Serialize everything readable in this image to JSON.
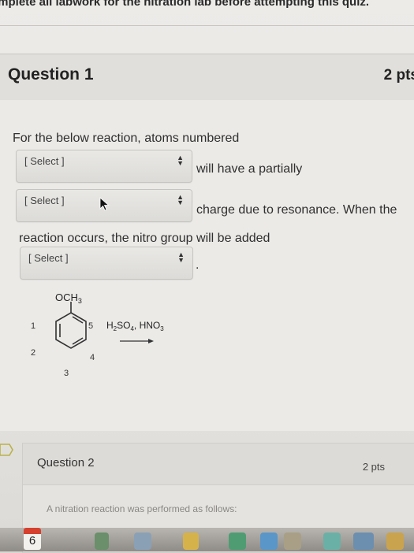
{
  "banner": {
    "text": "omplete all labwork for the nitration lab before attempting this quiz."
  },
  "question1": {
    "title": "Question 1",
    "points": "2 pts",
    "text_line1": "For the below reaction, atoms numbered",
    "select1": "[ Select ]",
    "text_after_select1": "will have a partially",
    "select2": "[ Select ]",
    "text_after_select2": "charge due to resonance. When the",
    "text_line3": "reaction occurs, the nitro group will be added",
    "select3": "[ Select ]",
    "text_after_select3": "."
  },
  "molecule": {
    "substituent": "OCH",
    "substituent_sub": "3",
    "atoms": [
      "1",
      "2",
      "3",
      "4",
      "5"
    ],
    "reagent": {
      "p1": "H",
      "s1": "2",
      "p2": "SO",
      "s2": "4",
      "p3": ", HNO",
      "s3": "3"
    }
  },
  "question2": {
    "title": "Question 2",
    "points": "2 pts",
    "text": "A nitration reaction was performed as follows:"
  },
  "dock": {
    "calendar_day": "6"
  },
  "colors": {
    "page_bg": "#eceae7",
    "header_bg": "#e1dfdb",
    "text": "#2f2f2f",
    "select_bg": "#e2e1de"
  }
}
